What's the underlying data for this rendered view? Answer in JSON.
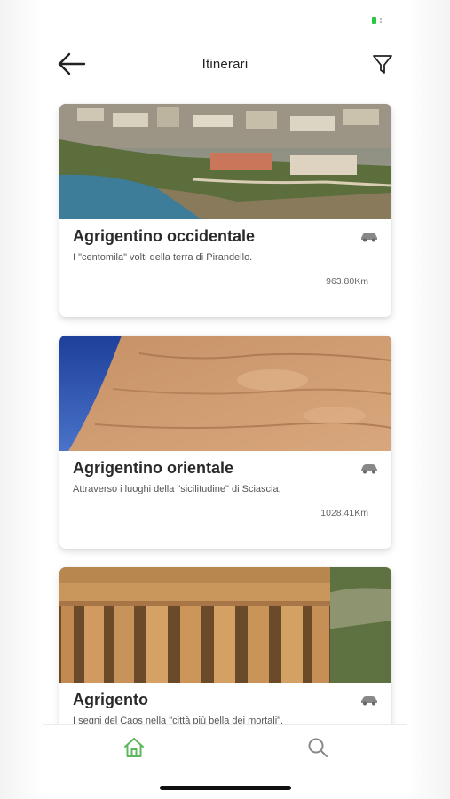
{
  "header": {
    "title": "Itinerari",
    "back_icon": "arrow-left-icon",
    "filter_icon": "filter-icon"
  },
  "status_bar": {
    "battery_color": "#27c93f"
  },
  "itineraries": [
    {
      "name": "Agrigentino occidentale",
      "description": "I \"centomila\" volti della terra di Pirandello.",
      "distance": "963.80Km",
      "transport_icon": "car-icon"
    },
    {
      "name": "Agrigentino orientale",
      "description": "Attraverso i luoghi della \"sicilitudine\" di Sciascia.",
      "distance": "1028.41Km",
      "transport_icon": "car-icon"
    },
    {
      "name": "Agrigento",
      "description": "I segni del Caos nella \"città più bella dei mortali\".",
      "transport_icon": "car-icon"
    }
  ],
  "bottom_nav": {
    "items": [
      {
        "icon": "home-icon",
        "active": true,
        "color": "#5cb85c"
      },
      {
        "icon": "search-icon",
        "active": false,
        "color": "#888888"
      }
    ]
  }
}
